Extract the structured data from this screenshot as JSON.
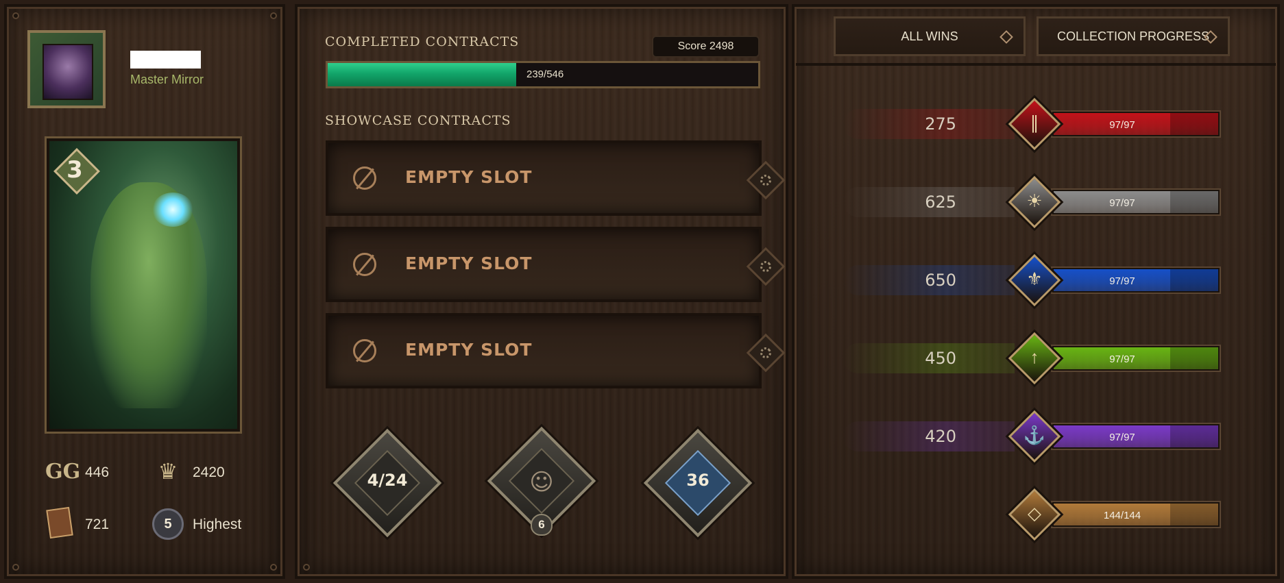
{
  "profile": {
    "rank_title": "Master Mirror",
    "card_level": "3",
    "stats": {
      "gg_value": "446",
      "crown_value": "2420",
      "cards_value": "721",
      "rank_badge": "5",
      "rank_label": "Highest"
    }
  },
  "contracts": {
    "completed_heading": "COMPLETED CONTRACTS",
    "score": "Score 2498",
    "progress_text": "239/546",
    "progress_fraction": 0.438,
    "showcase_heading": "SHOWCASE CONTRACTS",
    "slots": [
      "EMPTY SLOT",
      "EMPTY SLOT",
      "EMPTY SLOT"
    ]
  },
  "badges": {
    "left_value": "4/24",
    "center_sub": "6",
    "right_value": "36"
  },
  "tabs": {
    "wins": "ALL WINS",
    "collection": "COLLECTION PROGRESS"
  },
  "factions": [
    {
      "wins": "275",
      "progress": "97/97",
      "color": "#c2121a",
      "icon": "monsters-claw-icon",
      "glyph": "∥"
    },
    {
      "wins": "625",
      "progress": "97/97",
      "color": "#8c8c8c",
      "icon": "nilfgaard-sun-icon",
      "glyph": "☀"
    },
    {
      "wins": "650",
      "progress": "97/97",
      "color": "#1650c8",
      "icon": "northern-realms-lily-icon",
      "glyph": "⚜"
    },
    {
      "wins": "450",
      "progress": "97/97",
      "color": "#68b414",
      "icon": "scoiatael-arrows-icon",
      "glyph": "↑"
    },
    {
      "wins": "420",
      "progress": "97/97",
      "color": "#7a3ac8",
      "icon": "skellige-ship-icon",
      "glyph": "⚓"
    },
    {
      "wins": "",
      "progress": "144/144",
      "color": "#b07a3a",
      "icon": "neutral-diamond-icon",
      "glyph": "◇"
    }
  ]
}
